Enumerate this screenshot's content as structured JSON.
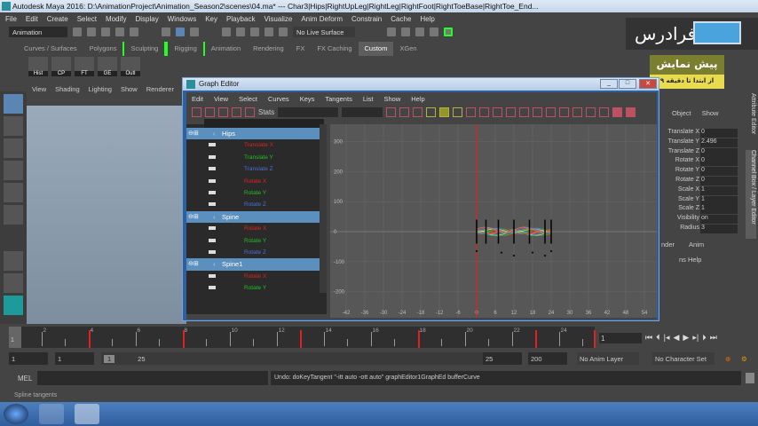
{
  "window": {
    "title": "Autodesk Maya 2016: D:\\AnimationProject\\Animation_Season2\\scenes\\04.ma*   ---   Char3|Hips|RightUpLeg|RightLeg|RightFoot|RightToeBase|RightToe_End..."
  },
  "menubar": [
    "File",
    "Edit",
    "Create",
    "Select",
    "Modify",
    "Display",
    "Windows",
    "Key",
    "Playback",
    "Visualize",
    "Anim Deform",
    "Constrain",
    "Cache",
    "Help"
  ],
  "statusline": {
    "menuset": "Animation",
    "live_surface": "No Live Surface"
  },
  "shelf_tabs": [
    "Curves / Surfaces",
    "Polygons",
    "Sculpting",
    "Rigging",
    "Animation",
    "Rendering",
    "FX",
    "FX Caching",
    "Custom",
    "XGen"
  ],
  "shelf_active": "Custom",
  "shelf_buttons": [
    "Hist",
    "CP",
    "FT",
    "GE",
    "Outl"
  ],
  "viewport_menu": [
    "View",
    "Shading",
    "Lighting",
    "Show",
    "Renderer"
  ],
  "logo": {
    "text": "فرادرس"
  },
  "promo": {
    "title": "پیش نمایش",
    "subtitle": "از ابتدا تا دقیقه ۹"
  },
  "graph_editor": {
    "title": "Graph Editor",
    "menu": [
      "Edit",
      "View",
      "Select",
      "Curves",
      "Keys",
      "Tangents",
      "List",
      "Show",
      "Help"
    ],
    "stats_label": "Stats",
    "outliner": [
      {
        "type": "node",
        "label": "Hips"
      },
      {
        "type": "attr",
        "label": "Translate X",
        "color": "#e02020"
      },
      {
        "type": "attr",
        "label": "Translate Y",
        "color": "#20c020"
      },
      {
        "type": "attr",
        "label": "Translate Z",
        "color": "#4a6fd8"
      },
      {
        "type": "attr",
        "label": "Rotate X",
        "color": "#e02020"
      },
      {
        "type": "attr",
        "label": "Rotate Y",
        "color": "#20c020"
      },
      {
        "type": "attr",
        "label": "Rotate Z",
        "color": "#4a6fd8"
      },
      {
        "type": "node",
        "label": "Spine"
      },
      {
        "type": "attr",
        "label": "Rotate X",
        "color": "#e02020"
      },
      {
        "type": "attr",
        "label": "Rotate Y",
        "color": "#20c020"
      },
      {
        "type": "attr",
        "label": "Rotate Z",
        "color": "#4a6fd8"
      },
      {
        "type": "node",
        "label": "Spine1"
      },
      {
        "type": "attr",
        "label": "Rotate X",
        "color": "#e02020"
      },
      {
        "type": "attr",
        "label": "Rotate Y",
        "color": "#20c020"
      }
    ],
    "y_ticks": [
      "300",
      "200",
      "100",
      "0",
      "-100",
      "-200"
    ],
    "x_ticks": [
      "-42",
      "-36",
      "-30",
      "-24",
      "-18",
      "-12",
      "-6",
      "0",
      "6",
      "12",
      "18",
      "24",
      "30",
      "36",
      "42",
      "48",
      "54"
    ],
    "current_time": 0
  },
  "channel_box": {
    "header": [
      "Object",
      "Show"
    ],
    "channels": [
      {
        "name": "Translate X",
        "value": "0"
      },
      {
        "name": "Translate Y",
        "value": "2.496"
      },
      {
        "name": "Translate Z",
        "value": "0"
      },
      {
        "name": "Rotate X",
        "value": "0"
      },
      {
        "name": "Rotate Y",
        "value": "0"
      },
      {
        "name": "Rotate Z",
        "value": "0"
      },
      {
        "name": "Scale X",
        "value": "1"
      },
      {
        "name": "Scale Y",
        "value": "1"
      },
      {
        "name": "Scale Z",
        "value": "1"
      },
      {
        "name": "Visibility",
        "value": "on"
      },
      {
        "name": "Radius",
        "value": "3"
      }
    ],
    "tab_attr": "Attribute Editor",
    "tab_cb": "Channel Box / Layer Editor",
    "layer_tabs": [
      "nder",
      "Anim"
    ],
    "layer_menu": "ns   Help"
  },
  "timeslider": {
    "labels": [
      "2",
      "4",
      "6",
      "8",
      "10",
      "12",
      "14",
      "16",
      "18",
      "20",
      "22",
      "24"
    ],
    "keys": [
      4,
      8,
      13,
      18,
      23,
      25.5
    ],
    "current": "1",
    "current_field": "1"
  },
  "range": {
    "start": "1",
    "start2": "1",
    "inner_start": "1",
    "inner_end": "25",
    "end": "25",
    "end2": "200",
    "anim_layer": "No Anim Layer",
    "char_set": "No Character Set"
  },
  "cmdline": {
    "label": "MEL",
    "output": "Undo: doKeyTangent \"-itt auto -ott auto\" graphEditor1GraphEd bufferCurve"
  },
  "helpline": "Spline tangents"
}
